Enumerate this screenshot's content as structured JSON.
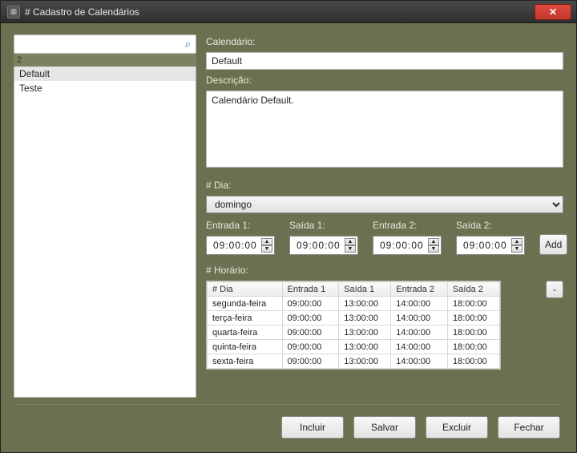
{
  "window": {
    "title": "# Cadastro de Calendários"
  },
  "sidebar": {
    "count": "2",
    "search_value": "",
    "items": [
      {
        "label": "Default",
        "selected": true
      },
      {
        "label": "Teste",
        "selected": false
      }
    ]
  },
  "form": {
    "calendar_label": "Calendário:",
    "calendar_value": "Default",
    "description_label": "Descrição:",
    "description_value": "Calendário Default.",
    "day_label": "# Dia:",
    "day_value": "domingo",
    "entrada1_label": "Entrada 1:",
    "entrada1_value": "09:00:00",
    "saida1_label": "Saída 1:",
    "saida1_value": "09:00:00",
    "entrada2_label": "Entrada 2:",
    "entrada2_value": "09:00:00",
    "saida2_label": "Saída 2:",
    "saida2_value": "09:00:00",
    "add_label": "Add",
    "schedule_label": "# Horário:",
    "remove_label": "-",
    "table": {
      "headers": [
        "# Dia",
        "Entrada 1",
        "Saída 1",
        "Entrada 2",
        "Saída 2"
      ],
      "rows": [
        [
          "segunda-feira",
          "09:00:00",
          "13:00:00",
          "14:00:00",
          "18:00:00"
        ],
        [
          "terça-feira",
          "09:00:00",
          "13:00:00",
          "14:00:00",
          "18:00:00"
        ],
        [
          "quarta-feira",
          "09:00:00",
          "13:00:00",
          "14:00:00",
          "18:00:00"
        ],
        [
          "quinta-feira",
          "09:00:00",
          "13:00:00",
          "14:00:00",
          "18:00:00"
        ],
        [
          "sexta-feira",
          "09:00:00",
          "13:00:00",
          "14:00:00",
          "18:00:00"
        ]
      ]
    }
  },
  "footer": {
    "incluir": "Incluir",
    "salvar": "Salvar",
    "excluir": "Excluir",
    "fechar": "Fechar"
  },
  "icons": {
    "search": "⌕",
    "close": "✕",
    "up": "▲",
    "down": "▼",
    "app": "▦"
  }
}
